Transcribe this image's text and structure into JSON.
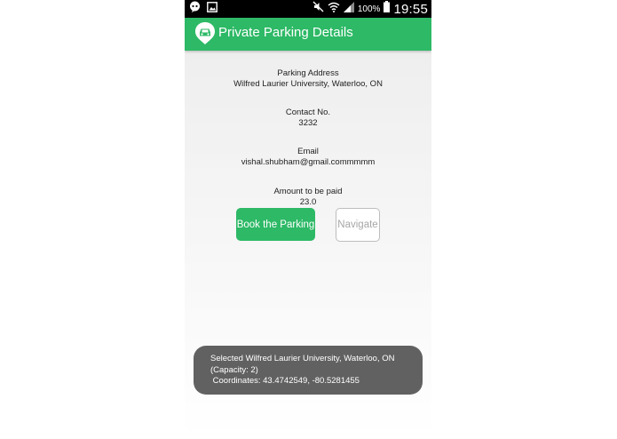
{
  "status_bar": {
    "icons_left": [
      "chat-bubble-icon",
      "image-notification-icon"
    ],
    "icons_right": [
      "mute-icon",
      "wifi-icon",
      "signal-icon",
      "battery-icon"
    ],
    "battery": "100%",
    "time": "19:55"
  },
  "app_bar": {
    "title": "Private Parking Details",
    "logo_icon": "parking-car-logo-icon",
    "color": "#2db966"
  },
  "details": {
    "address_label": "Parking Address",
    "address_value": "Wilfred Laurier University, Waterloo, ON",
    "contact_label": "Contact No.",
    "contact_value": "3232",
    "email_label": "Email",
    "email_value": "vishal.shubham@gmail.commmmm",
    "amount_label": "Amount to be paid",
    "amount_value": "23.0"
  },
  "buttons": {
    "book": "Book the Parking",
    "navigate": "Navigate"
  },
  "toast": {
    "line1": "Selected Wilfred Laurier University, Waterloo, ON",
    "line2": "(Capacity: 2)",
    "line3": " Coordinates: 43.4742549, -80.5281455"
  }
}
